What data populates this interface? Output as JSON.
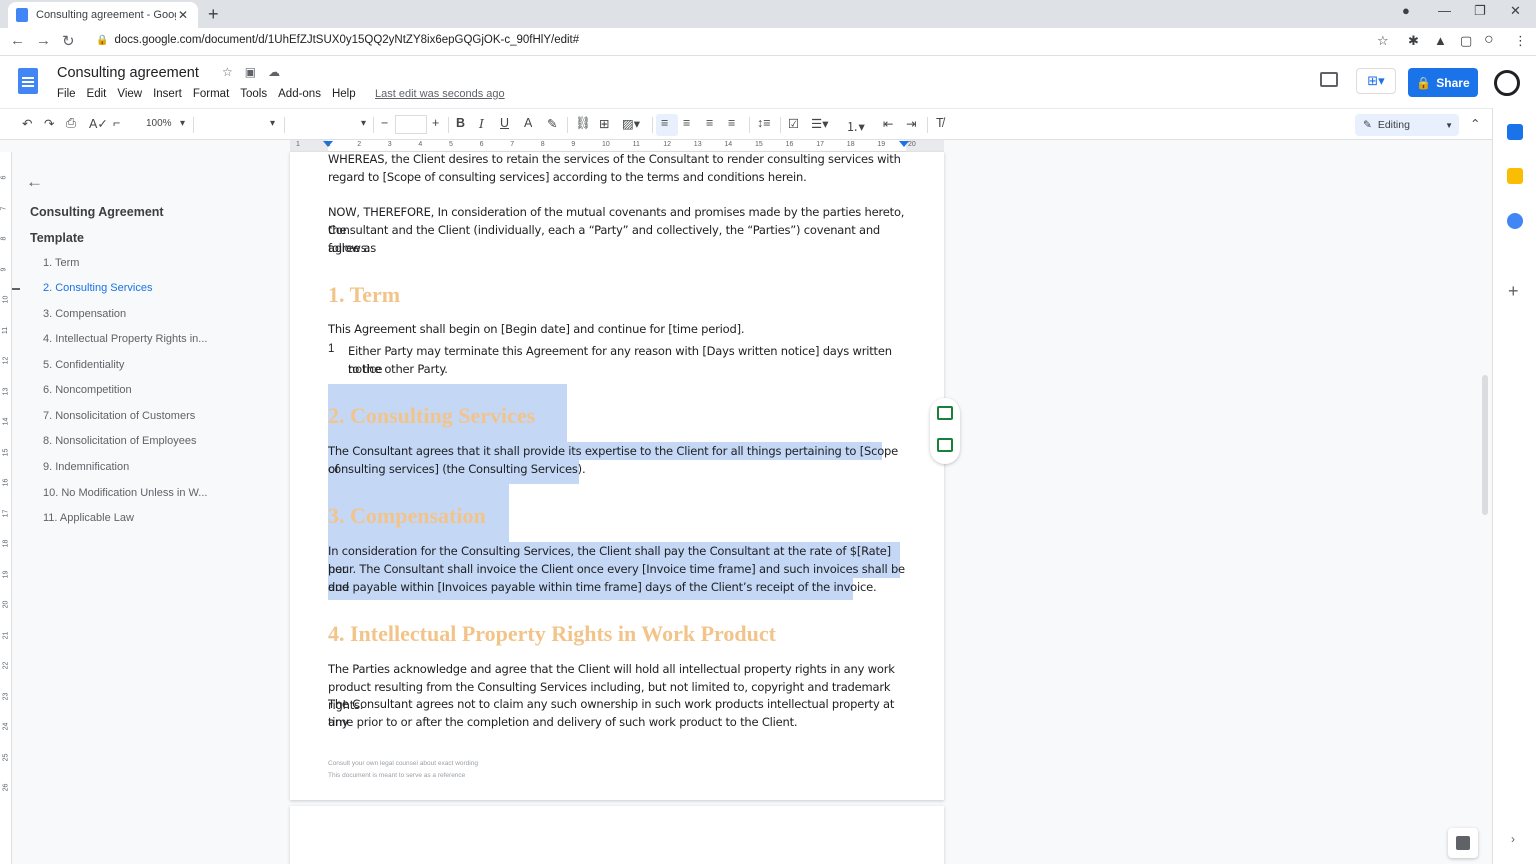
{
  "browser": {
    "tab_title": "Consulting agreement - Google",
    "tab_close": "✕",
    "new_tab": "+",
    "url": "docs.google.com/document/d/1UhEfZJtSUX0y15QQ2yNtZY8ix6epGQGjOK-c_90fHlY/edit#",
    "back": "←",
    "forward": "→",
    "reload": "↻",
    "bookmark": "☆",
    "minimize": "—",
    "restore": "❐",
    "close": "✕"
  },
  "docs": {
    "title": "Consulting agreement",
    "menu": [
      "File",
      "Edit",
      "View",
      "Insert",
      "Format",
      "Tools",
      "Add-ons",
      "Help"
    ],
    "last_edit": "Last edit was seconds ago",
    "share_label": "Share"
  },
  "toolbar": {
    "zoom": "100%",
    "mode": "Editing"
  },
  "ruler": {
    "h_numbers": [
      "1",
      "1",
      "2",
      "3",
      "4",
      "5",
      "6",
      "7",
      "8",
      "9",
      "10",
      "11",
      "12",
      "13",
      "14",
      "15",
      "16",
      "17",
      "18",
      "19",
      "20"
    ],
    "v_numbers": [
      "6",
      "7",
      "8",
      "9",
      "10",
      "11",
      "12",
      "13",
      "14",
      "15",
      "16",
      "17",
      "18",
      "19",
      "20",
      "21",
      "22",
      "23",
      "24",
      "25",
      "26"
    ]
  },
  "outline": {
    "title_line1": "Consulting Agreement",
    "title_line2": "Template",
    "items": [
      "1. Term",
      "2. Consulting Services",
      "3. Compensation",
      "4. Intellectual Property Rights in...",
      "5. Confidentiality",
      "6. Noncompetition",
      "7. Nonsolicitation of Customers",
      "8. Nonsolicitation of Employees",
      "9. Indemnification",
      "10. No Modification Unless in W...",
      "11. Applicable Law"
    ]
  },
  "document": {
    "whereas_1": "WHEREAS, the Client desires to retain the services of the Consultant to render consulting services with",
    "whereas_2": "regard to [Scope of consulting services] according to the terms and conditions herein.",
    "now_1": "NOW, THEREFORE, In consideration of the mutual covenants and promises made by the parties hereto, the",
    "now_2": "Consultant and the Client (individually, each a “Party” and collectively, the “Parties”) covenant and agree as",
    "now_3": "follows:",
    "h_term": "1. Term",
    "term_p": "This Agreement shall begin on [Begin date] and continue for [time period].",
    "term_li_num": "1",
    "term_li_1": "Either Party may terminate this Agreement for any reason with [Days written notice] days written notice",
    "term_li_2": "to the other Party.",
    "h_services": "2. Consulting Services",
    "services_1": "The Consultant agrees that it shall provide its expertise to the Client for all things pertaining to [Scope of",
    "services_2": "consulting services] (the Consulting Services).",
    "h_comp": "3. Compensation",
    "comp_1": "In consideration for the Consulting Services, the Client shall pay the Consultant at the rate of $[Rate] per",
    "comp_2": "hour. The Consultant shall invoice the Client once every [Invoice time frame] and such invoices shall be due",
    "comp_3": "and payable within [Invoices payable within time frame] days of the Client’s receipt of the invoice.",
    "h_ip": "4. Intellectual Property Rights in Work Product",
    "ip_1": "The Parties acknowledge and agree that the Client will hold all intellectual property rights in any work",
    "ip_2": "product resulting from the Consulting Services including, but not limited to, copyright and trademark rights.",
    "ip_3": "The Consultant agrees not to claim any such ownership in such work products intellectual property at any",
    "ip_4": "time prior to or after the completion and delivery of such work product to the Client.",
    "foot_1": "Consult your own legal counsel about exact wording",
    "foot_2": "This document is meant to serve as a reference"
  },
  "colors": {
    "accent": "#1a73e8",
    "heading": "#f3c48a",
    "selection": "#c4d7f5"
  }
}
